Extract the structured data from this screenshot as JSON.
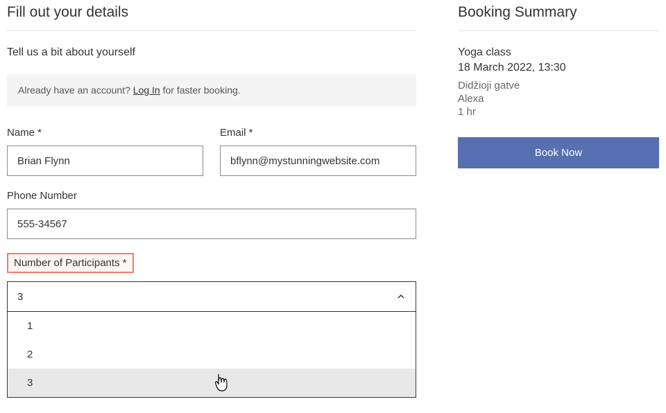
{
  "form": {
    "heading": "Fill out your details",
    "subheading": "Tell us a bit about yourself",
    "login_banner_pre": "Already have an account? ",
    "login_link": "Log In",
    "login_banner_post": " for faster booking.",
    "name_label": "Name *",
    "name_value": "Brian Flynn",
    "email_label": "Email *",
    "email_value": "bflynn@mystunningwebsite.com",
    "phone_label": "Phone Number",
    "phone_value": "555-34567",
    "participants_label": "Number of Participants *",
    "participants_value": "3",
    "participants_options": [
      "1",
      "2",
      "3"
    ]
  },
  "summary": {
    "heading": "Booking Summary",
    "service": "Yoga class",
    "datetime": "18 March 2022, 13:30",
    "location": "Didžioji gatvė",
    "staff": "Alexa",
    "duration": "1 hr",
    "button": "Book Now"
  }
}
